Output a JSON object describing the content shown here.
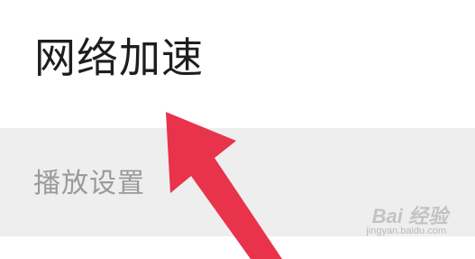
{
  "settings": {
    "network_acceleration_label": "网络加速",
    "playback_section_label": "播放设置"
  },
  "annotation": {
    "arrow_color": "#e8334a"
  },
  "watermark": {
    "logo_text": "Bai 经验",
    "url_text": "jingyan.baidu.com"
  },
  "colors": {
    "section_bg": "#eeeeee",
    "primary_text": "#1e1e1e",
    "secondary_text": "#9a9a9a"
  }
}
